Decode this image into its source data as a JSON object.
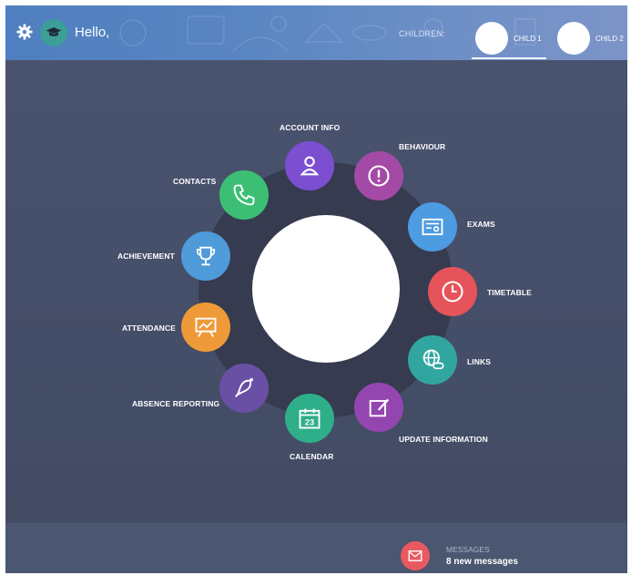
{
  "header": {
    "greeting": "Hello,",
    "children_label": "CHILDREN:",
    "children": [
      {
        "label": "CHILD 1"
      },
      {
        "label": "CHILD 2"
      }
    ]
  },
  "menu": {
    "items": [
      {
        "label": "ACCOUNT INFO",
        "color": "#7c4fd1",
        "icon": "user-icon"
      },
      {
        "label": "BEHAVIOUR",
        "color": "#a34aa6",
        "icon": "exclamation-icon"
      },
      {
        "label": "EXAMS",
        "color": "#4d9be0",
        "icon": "certificate-icon"
      },
      {
        "label": "TIMETABLE",
        "color": "#e5545a",
        "icon": "clock-icon"
      },
      {
        "label": "LINKS",
        "color": "#31a6a1",
        "icon": "globe-link-icon"
      },
      {
        "label": "UPDATE INFORMATION",
        "color": "#9446b0",
        "icon": "edit-icon"
      },
      {
        "label": "CALENDAR",
        "color": "#2fae8a",
        "icon": "calendar-icon",
        "icon_text": "23"
      },
      {
        "label": "ABSENCE REPORTING",
        "color": "#6a50a5",
        "icon": "bell-icon"
      },
      {
        "label": "ATTENDANCE",
        "color": "#ef9a38",
        "icon": "presentation-icon"
      },
      {
        "label": "ACHIEVEMENT",
        "color": "#4f9ad8",
        "icon": "trophy-icon"
      },
      {
        "label": "CONTACTS",
        "color": "#3cbf75",
        "icon": "phone-icon"
      }
    ]
  },
  "footer": {
    "messages_label": "MESSAGES",
    "messages_count": "8 new messages"
  }
}
